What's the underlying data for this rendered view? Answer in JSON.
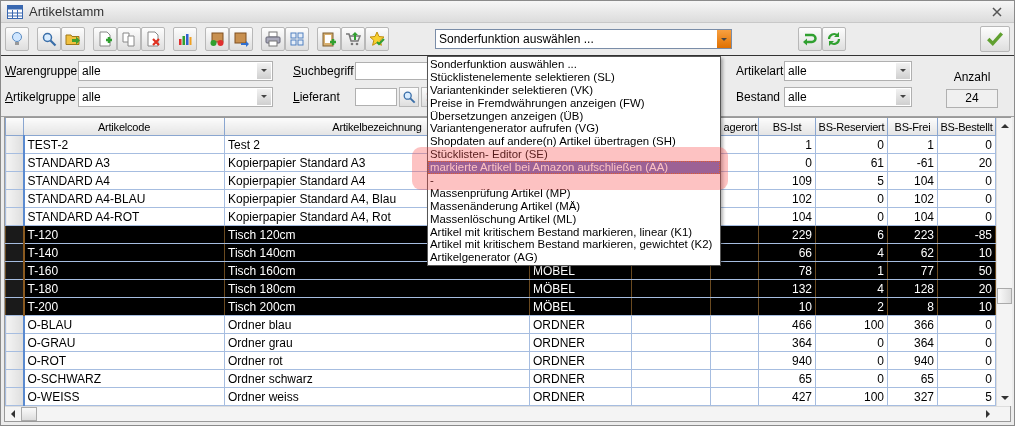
{
  "window": {
    "title": "Artikelstamm"
  },
  "function_combo": {
    "value": "Sonderfunktion auswählen ...",
    "expanded": true
  },
  "function_menu": [
    {
      "label": "Sonderfunktion auswählen ...",
      "selected": false,
      "annotated": false
    },
    {
      "label": "Stücklistenelemente selektieren (SL)",
      "selected": false,
      "annotated": false
    },
    {
      "label": "Variantenkinder selektieren (VK)",
      "selected": false,
      "annotated": false
    },
    {
      "label": "Preise in Fremdwährungen anzeigen (FW)",
      "selected": false,
      "annotated": false
    },
    {
      "label": "Übersetzungen anzeigen (ÜB)",
      "selected": false,
      "annotated": false
    },
    {
      "label": "Variantengenerator aufrufen (VG)",
      "selected": false,
      "annotated": false
    },
    {
      "label": "Shopdaten auf andere(n) Artikel übertragen (SH)",
      "selected": false,
      "annotated": false
    },
    {
      "label": "Stücklisten- Editor (SE)",
      "selected": false,
      "annotated": true
    },
    {
      "label": "markierte Artikel bei Amazon aufschließen (AA)",
      "selected": true,
      "annotated": true
    },
    {
      "label": "-",
      "selected": false,
      "annotated": true
    },
    {
      "label": "Massenprüfung Artikel (MP)",
      "selected": false,
      "annotated": false
    },
    {
      "label": "Massenänderung Artikel (MÄ)",
      "selected": false,
      "annotated": false
    },
    {
      "label": "Massenlöschung Artikel (ML)",
      "selected": false,
      "annotated": false
    },
    {
      "label": "Artikel mit kritischem Bestand markieren, linear (K1)",
      "selected": false,
      "annotated": false
    },
    {
      "label": "Artikel mit kritischem Bestand markieren, gewichtet (K2)",
      "selected": false,
      "annotated": false
    },
    {
      "label": "Artikelgenerator (AG)",
      "selected": false,
      "annotated": false
    }
  ],
  "filters": {
    "warengruppe": {
      "label": "Warengruppe",
      "value": "alle"
    },
    "artikelgruppe": {
      "label": "Artikelgruppe",
      "value": "alle"
    },
    "suchbegriff": {
      "label": "Suchbegriff"
    },
    "lieferant": {
      "label": "Lieferant"
    },
    "artikelart": {
      "label": "Artikelart",
      "value": "alle"
    },
    "bestand": {
      "label": "Bestand",
      "value": "alle"
    },
    "count": {
      "label": "Anzahl",
      "value": "24"
    }
  },
  "table": {
    "columns": [
      "Artikelcode",
      "Artikelbezeichnung",
      null,
      null,
      "agerort",
      "BS-Ist",
      "BS-Reserviert",
      "BS-Frei",
      "BS-Bestellt"
    ],
    "rows": [
      {
        "selected": false,
        "cells": [
          "TEST-2",
          "Test 2",
          null,
          null,
          null,
          "1",
          "0",
          "1",
          "0"
        ]
      },
      {
        "selected": false,
        "cells": [
          "STANDARD A3",
          "Kopierpapier Standard A3",
          null,
          null,
          null,
          "0",
          "61",
          "-61",
          "20"
        ]
      },
      {
        "selected": false,
        "cells": [
          "STANDARD A4",
          "Kopierpapier Standard A4",
          null,
          null,
          null,
          "109",
          "5",
          "104",
          "0"
        ]
      },
      {
        "selected": false,
        "cells": [
          "STANDARD A4-BLAU",
          "Kopierpapier Standard A4, Blau",
          null,
          null,
          null,
          "102",
          "0",
          "102",
          "0"
        ]
      },
      {
        "selected": false,
        "cells": [
          "STANDARD A4-ROT",
          "Kopierpapier Standard A4, Rot",
          null,
          null,
          null,
          "104",
          "0",
          "104",
          "0"
        ]
      },
      {
        "selected": true,
        "cells": [
          "T-120",
          "Tisch 120cm",
          null,
          null,
          null,
          "229",
          "6",
          "223",
          "-85"
        ]
      },
      {
        "selected": true,
        "cells": [
          "T-140",
          "Tisch 140cm",
          null,
          null,
          null,
          "66",
          "4",
          "62",
          "10"
        ]
      },
      {
        "selected": true,
        "cells": [
          "T-160",
          "Tisch 160cm",
          "MÖBEL",
          null,
          null,
          "78",
          "1",
          "77",
          "50"
        ]
      },
      {
        "selected": true,
        "cells": [
          "T-180",
          "Tisch 180cm",
          "MÖBEL",
          null,
          null,
          "132",
          "4",
          "128",
          "20"
        ]
      },
      {
        "selected": true,
        "cells": [
          "T-200",
          "Tisch 200cm",
          "MÖBEL",
          null,
          null,
          "10",
          "2",
          "8",
          "10"
        ]
      },
      {
        "selected": false,
        "cells": [
          "O-BLAU",
          "Ordner blau",
          "ORDNER",
          null,
          null,
          "466",
          "100",
          "366",
          "0"
        ]
      },
      {
        "selected": false,
        "cells": [
          "O-GRAU",
          "Ordner grau",
          "ORDNER",
          null,
          null,
          "364",
          "0",
          "364",
          "0"
        ]
      },
      {
        "selected": false,
        "cells": [
          "O-ROT",
          "Ordner rot",
          "ORDNER",
          null,
          null,
          "940",
          "0",
          "940",
          "0"
        ]
      },
      {
        "selected": false,
        "cells": [
          "O-SCHWARZ",
          "Ordner schwarz",
          "ORDNER",
          null,
          null,
          "65",
          "0",
          "65",
          "0"
        ]
      },
      {
        "selected": false,
        "cells": [
          "O-WEISS",
          "Ordner weiss",
          "ORDNER",
          null,
          null,
          "427",
          "100",
          "327",
          "5"
        ]
      }
    ]
  }
}
